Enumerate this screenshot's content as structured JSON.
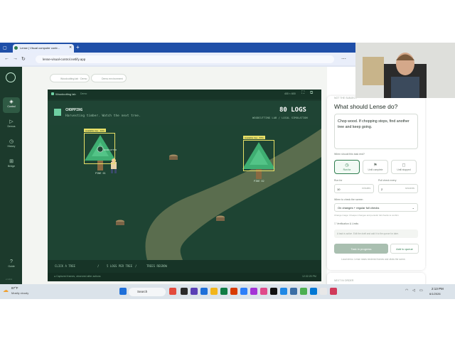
{
  "browser": {
    "tab_title": "Lense | Visual computer contr...",
    "url": "lense-visual-control.netlify.app"
  },
  "sidebar": {
    "items": [
      {
        "label": "Control",
        "icon": "control-icon"
      },
      {
        "label": "Demos",
        "icon": "play-icon"
      },
      {
        "label": "History",
        "icon": "history-icon"
      },
      {
        "label": "Bridge",
        "icon": "bridge-icon"
      }
    ],
    "bottom_item": {
      "label": "Guide",
      "icon": "help-icon"
    },
    "version": "v 1.0.1"
  },
  "toolbar": {
    "pill1": "Woodcutting lab  · Demo",
    "pill2": "Demo environment"
  },
  "game": {
    "window_title": "Woodcutting lab",
    "window_badge": "Demo",
    "window_controls": "400 × 600",
    "status": "CHOPPING",
    "substatus": "Harvesting timber. Watch the next tree.",
    "logs": "80 LOGS",
    "mode": "WOODCUTTING LAB / LOCAL SIMULATION",
    "trees": [
      {
        "name": "PINE 01",
        "tag": "Available tree · 91%"
      },
      {
        "name": "PINE 02",
        "tag": "Available tree · 87%"
      }
    ],
    "player_tag": "WOODCUTTER",
    "footer": [
      "CLICK A TREE",
      "/",
      "5 LOGS PER TREE",
      "/",
      "TREES REGROW"
    ],
    "status_left": "● Captured frames, observed after actions",
    "status_right": "12:32:25 PM"
  },
  "panel": {
    "kicker": "NOT THE SUBJECT",
    "title": "What should Lense do?",
    "prompt": "Chop wood. If chopping stops, find another tree and keep going.",
    "when_label": "When should this task end?",
    "modes": [
      {
        "label": "Run for",
        "icon": "clock-icon",
        "selected": true
      },
      {
        "label": "Until complete",
        "icon": "flag-icon",
        "selected": false
      },
      {
        "label": "Until stopped",
        "icon": "stop-icon",
        "selected": false
      }
    ],
    "run_for_label": "Run for",
    "run_for_value": "10",
    "run_for_unit": "minutes",
    "check_label": "Pull check every",
    "check_value": "2",
    "check_unit": "seconds",
    "watch_label": "When to check the screen",
    "watch_value": "On changes + regular full checks",
    "watch_hint": "Change image: Cheaper changes and periodic full checks to confirm",
    "verify_label": "Verification & Limits",
    "note": "A task is active. Edit the draft and add it to the queue for later.",
    "task_button": "Task in progress",
    "queue_button": "Add to queue",
    "footer_note": "Local demo. Lense reads rendered frames and clicks the scene.",
    "next_label": "NEXT IN ORDER"
  },
  "taskbar": {
    "temp": "87°F",
    "weather": "Mostly cloudy",
    "search": "Search",
    "time": "2:13 PM",
    "date": "6/1/2026"
  },
  "colors": {
    "brand_green": "#2e7d4f",
    "sidebar_bg": "#1c3a2c",
    "game_bg": "#1e4433",
    "detection": "#e8e067",
    "status_accent": "#6fd0a3"
  }
}
